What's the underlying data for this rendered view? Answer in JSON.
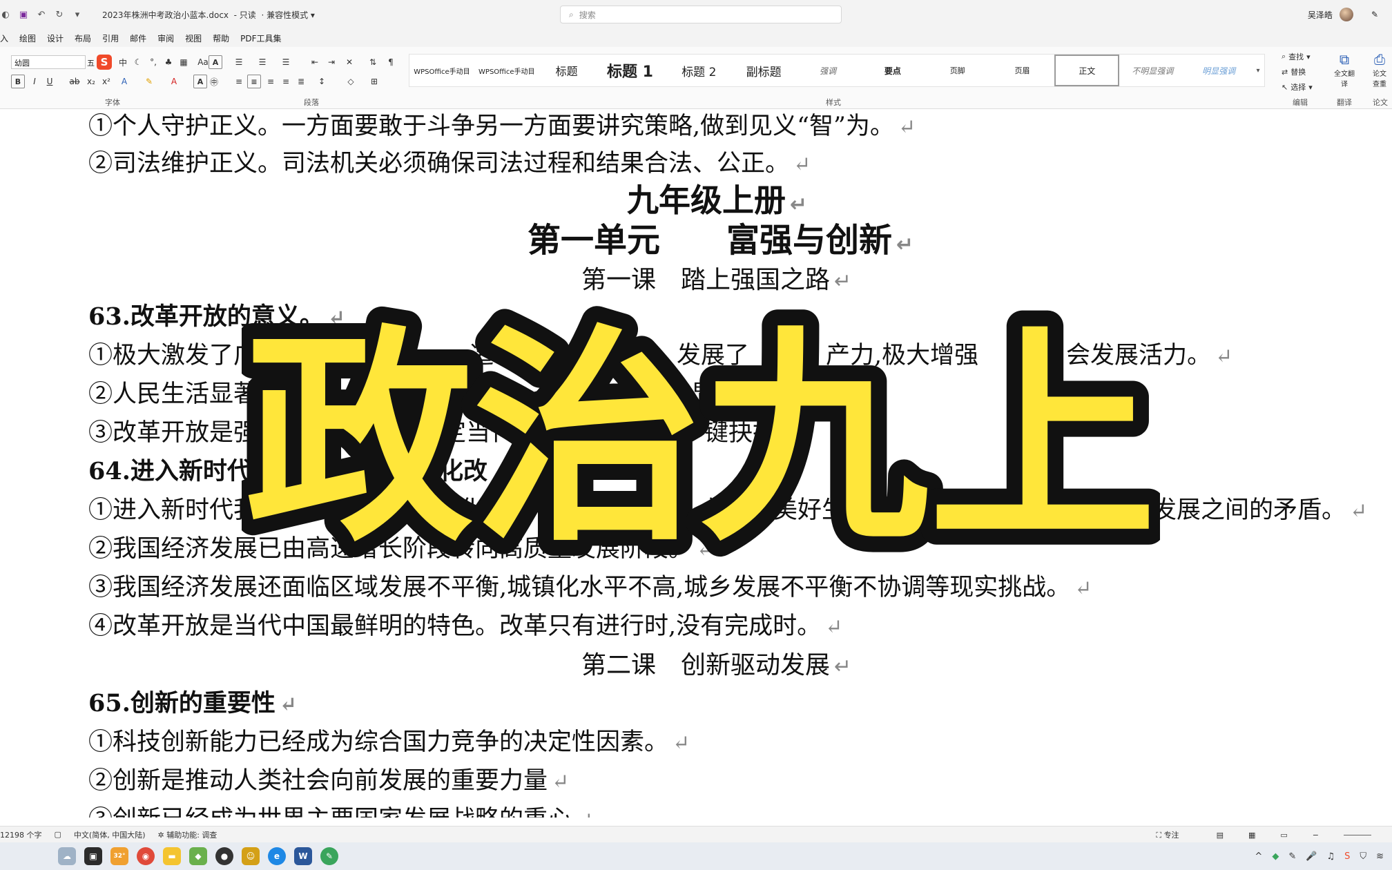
{
  "titlebar": {
    "doc_title": "2023年株洲中考政治小蓝本.docx",
    "mode": "只读",
    "compat": "兼容性模式",
    "search_placeholder": "搜索",
    "user_name": "吴泽皓"
  },
  "menu": {
    "items": [
      "入",
      "绘图",
      "设计",
      "布局",
      "引用",
      "邮件",
      "审阅",
      "视图",
      "帮助",
      "PDF工具集"
    ]
  },
  "ribbon": {
    "font_name": "幼圆",
    "font_size": "五",
    "group_font": "字体",
    "group_paragraph": "段落",
    "group_styles": "样式",
    "group_editing": "编辑",
    "group_translate": "翻译",
    "group_paper": "论文",
    "styles": [
      "WPSOffice手动目",
      "WPSOffice手动目",
      "标题",
      "标题 1",
      "标题 2",
      "副标题",
      "强调",
      "要点",
      "页脚",
      "页眉",
      "正文",
      "不明显强调",
      "明显强调"
    ],
    "find": "查找",
    "replace": "替换",
    "select": "选择",
    "full_translate": "全文翻译",
    "paper_check": "论文查重"
  },
  "document": {
    "lines": [
      "①个人守护正义。一方面要敢于斗争另一方面要讲究策略,做到见义“智”为。",
      "②司法维护正义。司法机关必须确保司法过程和结果合法、公正。",
      "九年级上册",
      "第一单元　　富强与创新",
      "第一课　踏上强国之路",
      "63.改革开放的意义。",
      "①极大激发了广",
      "造",
      "发展了",
      "产力,极大增强",
      "会发展活力。",
      "②人民生活显著",
      "显",
      "显",
      "③改革开放是强",
      "定当代",
      "键抉择",
      "64.进入新时代",
      "化改",
      "①进入新时代我国社会主要",
      "已经转化",
      "益增长",
      "美好生活需要和",
      "的发展之间的矛盾。",
      "②我国经济发展已由高速增长阶段转向高质量发展阶段。",
      "③我国经济发展还面临区域发展不平衡,城镇化水平不高,城乡发展不平衡不协调等现实挑战。",
      "④改革开放是当代中国最鲜明的特色。改革只有进行时,没有完成时。",
      "第二课　创新驱动发展",
      "65.创新的重要性",
      "①科技创新能力已经成为综合国力竞争的决定性因素。",
      "②创新是推动人类社会向前发展的重要力量",
      "③创新已经成为世界主要国家发展战略的重心"
    ],
    "paragraph_mark": "↵"
  },
  "overlay": {
    "title": "政治九上",
    "fill_color": "#ffe63a",
    "stroke_color": "#111111"
  },
  "statusbar": {
    "word_count": "12198 个字",
    "language": "中文(简体, 中国大陆)",
    "accessibility": "辅助功能: 调查",
    "focus": "专注"
  },
  "taskbar": {
    "temperature": "32°"
  }
}
